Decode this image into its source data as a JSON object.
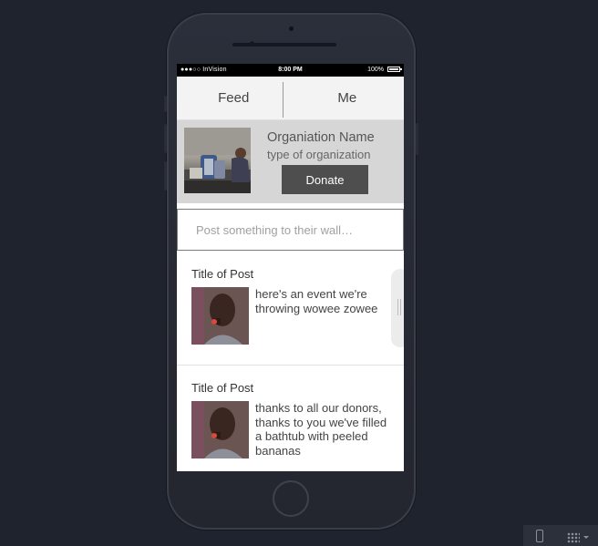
{
  "status_bar": {
    "carrier": "●●●○○ InVision",
    "wifi_icon": "wifi-icon",
    "time": "8:00 PM",
    "battery": "100%"
  },
  "tabs": [
    {
      "label": "Feed"
    },
    {
      "label": "Me"
    }
  ],
  "organization": {
    "name": "Organiation Name",
    "type": "type of organization",
    "donate_label": "Donate"
  },
  "composer": {
    "placeholder": "Post something to their wall…"
  },
  "posts": [
    {
      "title": "Title of Post",
      "text": "here's an event we're throwing wowee zowee"
    },
    {
      "title": "Title of Post",
      "text": "thanks to all our donors, thanks to you we've filled a bathtub with peeled bananas"
    }
  ],
  "colors": {
    "background": "#1f232e",
    "donate_button": "#4e4e4e",
    "org_header": "#d6d6d6",
    "tab_bar": "#f3f3f3"
  }
}
